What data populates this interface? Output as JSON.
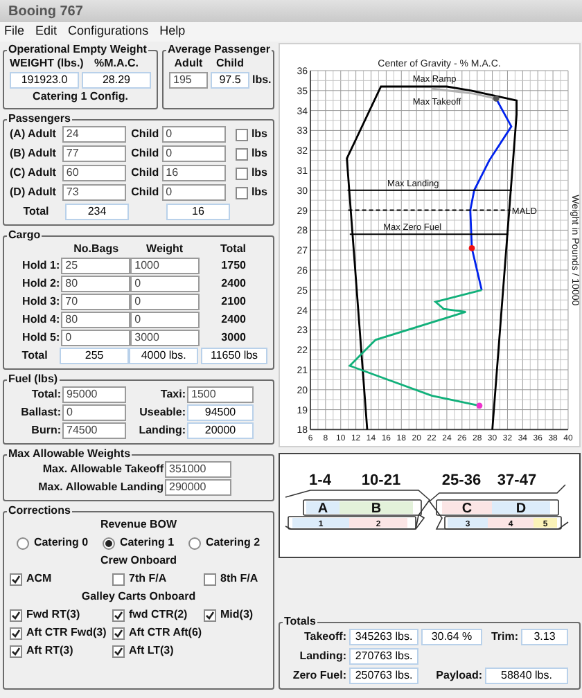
{
  "window": {
    "title": "Booing 767"
  },
  "menu": [
    "File",
    "Edit",
    "Configurations",
    "Help"
  ],
  "empty_weight": {
    "title": "Operational Empty Weight",
    "weight_label": "WEIGHT (lbs.)",
    "mac_label": "%M.A.C.",
    "weight": "191923.0",
    "mac": "28.29",
    "note": "Catering 1 Config."
  },
  "average_passenger": {
    "title": "Average Passenger",
    "adult_label": "Adult",
    "child_label": "Child",
    "adult": "195",
    "child": "97.5",
    "unit": "lbs."
  },
  "passengers": {
    "title": "Passengers",
    "rows": [
      {
        "label": "(A) Adult",
        "adult": "24",
        "child_label": "Child",
        "child": "0",
        "unit": "lbs",
        "checked": false
      },
      {
        "label": "(B) Adult",
        "adult": "77",
        "child_label": "Child",
        "child": "0",
        "unit": "lbs",
        "checked": false
      },
      {
        "label": "(C) Adult",
        "adult": "60",
        "child_label": "Child",
        "child": "16",
        "unit": "lbs",
        "checked": false
      },
      {
        "label": "(D) Adult",
        "adult": "73",
        "child_label": "Child",
        "child": "0",
        "unit": "lbs",
        "checked": false
      }
    ],
    "total": {
      "label": "Total",
      "adult": "234",
      "child": "16"
    }
  },
  "cargo": {
    "title": "Cargo",
    "columns": [
      "No.Bags",
      "Weight",
      "Total"
    ],
    "rows": [
      {
        "label": "Hold 1:",
        "bags": "25",
        "weight": "1000",
        "total": "1750"
      },
      {
        "label": "Hold 2:",
        "bags": "80",
        "weight": "0",
        "total": "2400"
      },
      {
        "label": "Hold 3:",
        "bags": "70",
        "weight": "0",
        "total": "2100"
      },
      {
        "label": "Hold 4:",
        "bags": "80",
        "weight": "0",
        "total": "2400"
      },
      {
        "label": "Hold 5:",
        "bags": "0",
        "weight": "3000",
        "total": "3000"
      }
    ],
    "total": {
      "label": "Total",
      "bags": "255",
      "weight": "4000 lbs.",
      "total": "11650 lbs"
    }
  },
  "fuel": {
    "title": "Fuel (lbs)",
    "fields": [
      {
        "label": "Total:",
        "value": "95000",
        "editable": true
      },
      {
        "label": "Taxi:",
        "value": "1500",
        "editable": true
      },
      {
        "label": "Ballast:",
        "value": "0",
        "editable": true
      },
      {
        "label": "Useable:",
        "value": "94500",
        "editable": false
      },
      {
        "label": "Burn:",
        "value": "74500",
        "editable": true
      },
      {
        "label": "Landing:",
        "value": "20000",
        "editable": false
      }
    ]
  },
  "max_weights": {
    "title": "Max Allowable Weights",
    "fields": [
      {
        "label": "Max. Allowable Takeoff",
        "value": "351000"
      },
      {
        "label": "Max. Allowable Landing",
        "value": "290000"
      }
    ]
  },
  "corrections": {
    "title": "Corrections",
    "bow_title": "Revenue BOW",
    "catering": [
      {
        "label": "Catering 0",
        "selected": false
      },
      {
        "label": "Catering 1",
        "selected": true
      },
      {
        "label": "Catering 2",
        "selected": false
      }
    ],
    "crew_title": "Crew Onboard",
    "crew": [
      {
        "label": "ACM",
        "checked": true
      },
      {
        "label": "7th F/A",
        "checked": false
      },
      {
        "label": "8th F/A",
        "checked": false
      }
    ],
    "galley_title": "Galley Carts Onboard",
    "cart_rows": [
      {
        "items": [
          {
            "label": "Fwd RT(3)",
            "checked": true
          },
          {
            "label": "fwd CTR(2)",
            "checked": true
          },
          {
            "label": "Mid(3)",
            "checked": true
          }
        ]
      },
      {
        "items": [
          {
            "label": "Aft CTR Fwd(3)",
            "checked": true
          },
          {
            "label": "Aft CTR Aft(6)",
            "checked": true
          }
        ]
      },
      {
        "items": [
          {
            "label": "Aft RT(3)",
            "checked": true
          },
          {
            "label": "Aft LT(3)",
            "checked": true
          }
        ]
      }
    ]
  },
  "chart": {
    "chart_data": {
      "type": "line",
      "title": "Center of Gravity - % M.A.C.",
      "ylabel": "Weight in Pounds / 10000",
      "xlim": [
        6,
        40
      ],
      "ylim": [
        18,
        36
      ],
      "xticks": [
        6,
        8,
        10,
        12,
        14,
        16,
        18,
        20,
        22,
        24,
        26,
        28,
        30,
        32,
        34,
        36,
        38,
        40
      ],
      "yticks": [
        18,
        19,
        20,
        21,
        22,
        23,
        24,
        25,
        26,
        27,
        28,
        29,
        30,
        31,
        32,
        33,
        34,
        35,
        36
      ],
      "grid": true,
      "series": [
        {
          "color": "#000000",
          "x": [
            13.5,
            10.8,
            15.3,
            24,
            27.2,
            33.2,
            33.2,
            30
          ],
          "values": [
            18,
            31.6,
            35.2,
            35.2,
            35.0,
            34.5,
            33.8,
            18
          ]
        },
        {
          "color": "#b0b0b0",
          "x": [
            22,
            27.5,
            30.5
          ],
          "values": [
            35.1,
            34.85,
            34.6
          ]
        },
        {
          "color": "#0022ee",
          "x": [
            30.5,
            32.5,
            29.6,
            27.6,
            27.1,
            27.3,
            28.6
          ],
          "values": [
            34.6,
            33.2,
            31.5,
            30,
            29,
            27.1,
            25
          ]
        },
        {
          "color": "#11b07a",
          "x": [
            28.6,
            22.5,
            23.6,
            26.5,
            14.6,
            11.2,
            22,
            28.3
          ],
          "values": [
            25,
            24.4,
            24.05,
            23.9,
            22.5,
            21.2,
            19.7,
            19.2
          ]
        },
        {
          "color": "#ee1111",
          "x": [
            27.3
          ],
          "values": [
            27.1
          ],
          "marker": true
        },
        {
          "color": "#ee33cc",
          "x": [
            28.3
          ],
          "values": [
            19.2
          ],
          "marker": true
        },
        {
          "color": "#555555",
          "x": [
            30.5
          ],
          "values": [
            34.6
          ],
          "marker": true
        },
        {
          "name": "Max Landing",
          "color": "#000000",
          "x": [
            10.9,
            32.6
          ],
          "values": [
            30,
            30
          ]
        },
        {
          "name": "MALD",
          "color": "#000000",
          "x": [
            11,
            32.4
          ],
          "values": [
            29,
            29
          ],
          "line_style": "dashed"
        },
        {
          "name": "Max Zero Fuel",
          "color": "#000000",
          "x": [
            11.2,
            32.1
          ],
          "values": [
            27.8,
            27.8
          ]
        }
      ],
      "annotations": [
        "Max Ramp",
        "Max Takeoff"
      ]
    }
  },
  "seat_map": {
    "zones": [
      "1-4",
      "10-21",
      "25-36",
      "37-47"
    ],
    "sections": [
      {
        "label": "A",
        "color": "#dcecfa"
      },
      {
        "label": "B",
        "color": "#e3f1da"
      },
      {
        "label": "C",
        "color": "#fbe5e5"
      },
      {
        "label": "D",
        "color": "#dcecfa"
      }
    ],
    "holds": [
      {
        "label": "1",
        "color": "#dcecfa"
      },
      {
        "label": "2",
        "color": "#fbe5e5"
      },
      {
        "label": "3",
        "color": "#dcecfa"
      },
      {
        "label": "4",
        "color": "#fbe5e5"
      },
      {
        "label": "5",
        "color": "#fbf3b8"
      }
    ]
  },
  "totals": {
    "title": "Totals",
    "takeoff_label": "Takeoff:",
    "takeoff": "345263 lbs.",
    "mac": "30.64 %",
    "trim_label": "Trim:",
    "trim": "3.13",
    "landing_label": "Landing:",
    "landing": "270763 lbs.",
    "zero_fuel_label": "Zero Fuel:",
    "zero_fuel": "250763 lbs.",
    "payload_label": "Payload:",
    "payload": "58840 lbs."
  }
}
